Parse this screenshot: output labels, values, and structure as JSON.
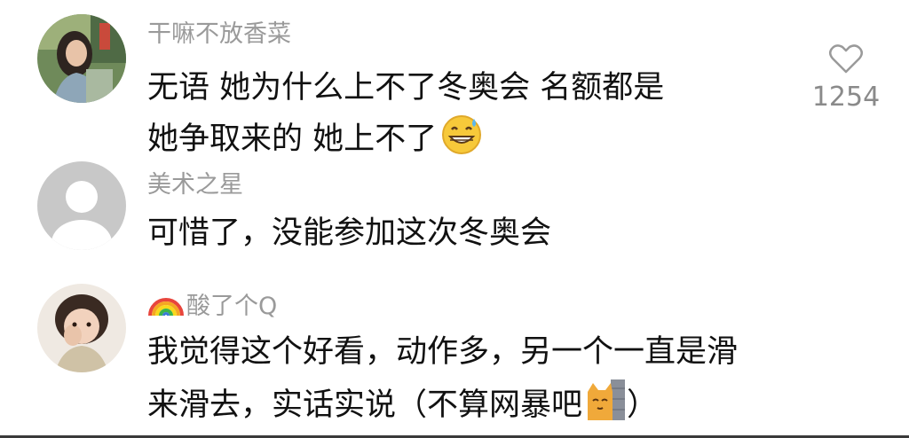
{
  "comments": [
    {
      "username": "干嘛不放香菜",
      "lines": [
        "无语 她为什么上不了冬奥会 名额都是",
        "她争取来的 她上不了"
      ],
      "trailing_emoji": "grinning-sweat-emoji",
      "like_count": "1254",
      "like_icon": "heart-outline-icon"
    },
    {
      "username": "美术之星",
      "lines": [
        "可惜了，没能参加这次冬奥会"
      ],
      "avatar_icon": "default-user-avatar"
    },
    {
      "username_prefix_icon": "rainbow-emoji",
      "username": "酸了个Q",
      "lines": [
        "我觉得这个好看，动作多，另一个一直是滑",
        "来滑去，实话实说（不算网暴吧"
      ],
      "trailing_emoji": "cat-peeking-emoji",
      "trailing_text": "）"
    }
  ],
  "colors": {
    "username": "#9a9a9a",
    "body_text": "#111111",
    "like_count": "#8a8a8a",
    "default_avatar_bg": "#c8c8c8"
  }
}
